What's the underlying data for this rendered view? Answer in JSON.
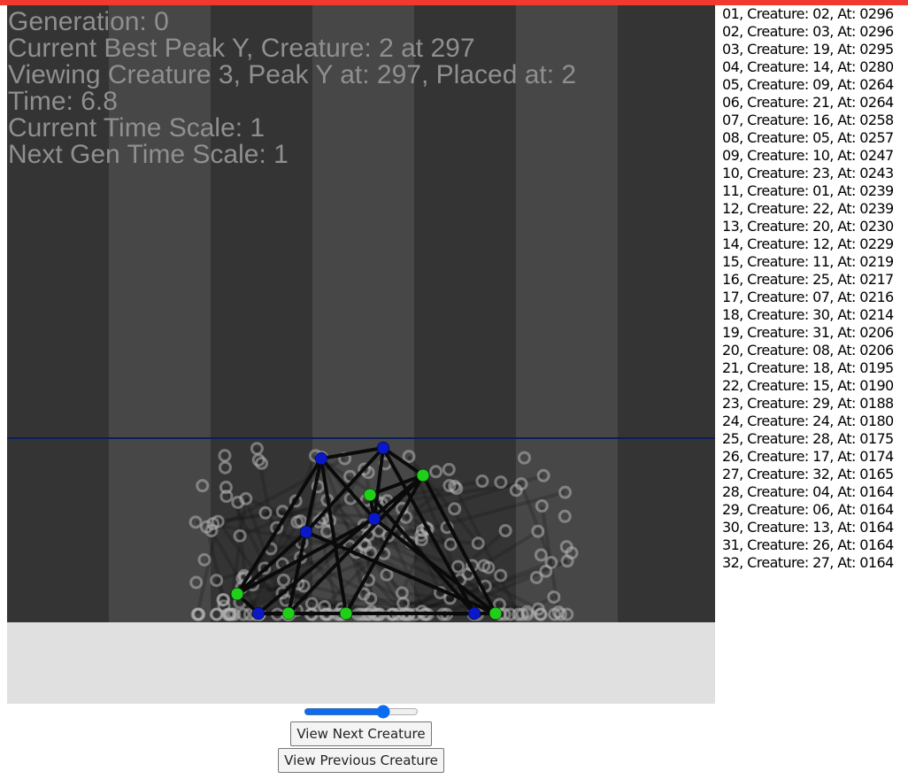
{
  "colors": {
    "top_bar": "#f0392f",
    "stripe_dark": "#343434",
    "stripe_light": "#474747",
    "ground": "#e0e0e0",
    "peak_line": "#0c1e55",
    "node_blue": "#0a18c8",
    "node_green": "#1fd018",
    "edge": "#0a0a0a",
    "ghost": "#b4b4b4"
  },
  "hud": {
    "generation": "Generation: 0",
    "best_peak": "Current Best Peak Y, Creature: 2 at 297",
    "viewing": "Viewing Creature 3, Peak Y at: 297, Placed at: 2",
    "time": "Time: 6.8",
    "time_scale": "Current Time Scale: 1",
    "next_gen_time_scale": "Next Gen Time Scale: 1"
  },
  "leaderboard": [
    "01, Creature: 02, At: 0296",
    "02, Creature: 03, At: 0296",
    "03, Creature: 19, At: 0295",
    "04, Creature: 14, At: 0280",
    "05, Creature: 09, At: 0264",
    "06, Creature: 21, At: 0264",
    "07, Creature: 16, At: 0258",
    "08, Creature: 05, At: 0257",
    "09, Creature: 10, At: 0247",
    "10, Creature: 23, At: 0243",
    "11, Creature: 01, At: 0239",
    "12, Creature: 22, At: 0239",
    "13, Creature: 20, At: 0230",
    "14, Creature: 12, At: 0229",
    "15, Creature: 11, At: 0219",
    "16, Creature: 25, At: 0217",
    "17, Creature: 07, At: 0216",
    "18, Creature: 30, At: 0214",
    "19, Creature: 31, At: 0206",
    "20, Creature: 08, At: 0206",
    "21, Creature: 18, At: 0195",
    "22, Creature: 15, At: 0190",
    "23, Creature: 29, At: 0188",
    "24, Creature: 24, At: 0180",
    "25, Creature: 28, At: 0175",
    "26, Creature: 17, At: 0174",
    "27, Creature: 32, At: 0165",
    "28, Creature: 04, At: 0164",
    "29, Creature: 06, At: 0164",
    "30, Creature: 13, At: 0164",
    "31, Creature: 26, At: 0164",
    "32, Creature: 27, At: 0164"
  ],
  "controls": {
    "slider_value": 0.72,
    "next_label": "View Next Creature",
    "prev_label": "View Previous Creature"
  }
}
